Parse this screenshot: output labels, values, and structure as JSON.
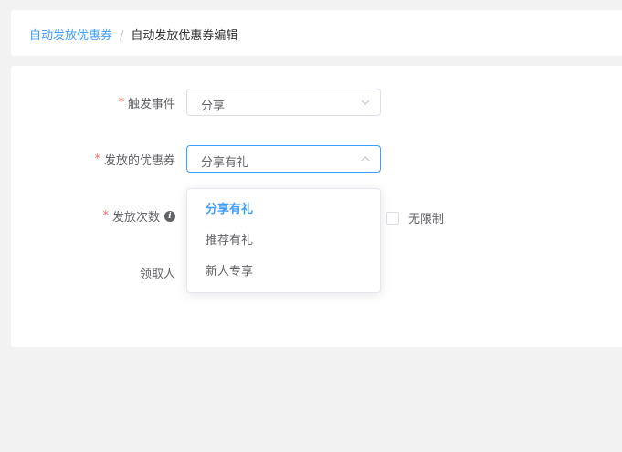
{
  "breadcrumb": {
    "parent": "自动发放优惠券",
    "separator": "/",
    "current": "自动发放优惠券编辑"
  },
  "form": {
    "required_mark": "*",
    "trigger_event": {
      "label": "触发事件",
      "value": "分享"
    },
    "coupon": {
      "label": "发放的优惠券",
      "value": "分享有礼"
    },
    "issue_count": {
      "label": "发放次数",
      "unlimited_label": "无限制",
      "unlimited_checked": false
    },
    "recipient": {
      "label": "领取人"
    }
  },
  "dropdown": {
    "options": [
      "分享有礼",
      "推荐有礼",
      "新人专享"
    ],
    "selected_index": 0
  },
  "colors": {
    "accent": "#409eff",
    "required": "#f56c6c",
    "text": "#606266",
    "background": "#f2f2f2"
  }
}
